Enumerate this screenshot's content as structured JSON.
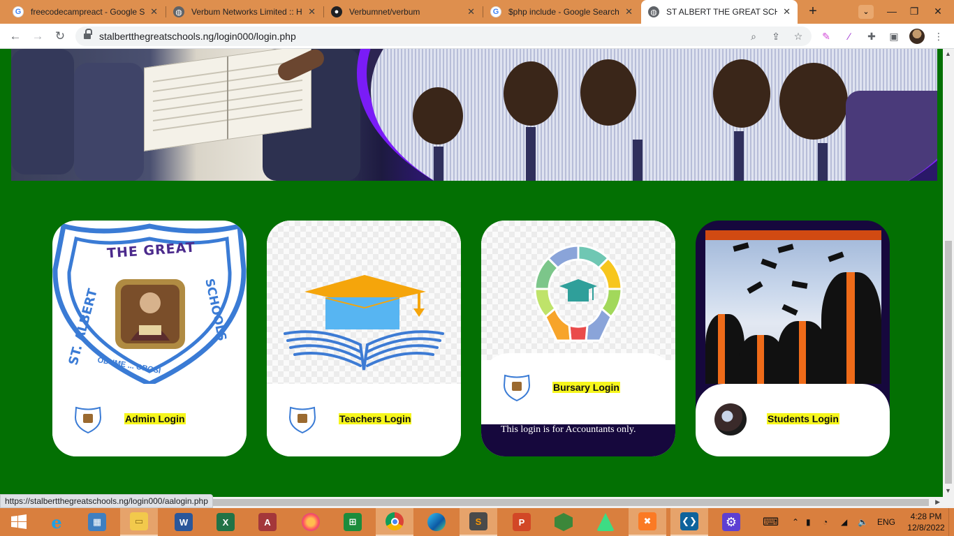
{
  "browser": {
    "tabs": [
      {
        "title": "freecodecampreact - Google S",
        "favicon": "google-icon"
      },
      {
        "title": "Verbum Networks Limited :: Ho",
        "favicon": "globe-icon"
      },
      {
        "title": "Verbumnet/verbum",
        "favicon": "github-icon"
      },
      {
        "title": "$php include - Google Search",
        "favicon": "google-icon"
      },
      {
        "title": "ST ALBERT THE GREAT SCHOO",
        "favicon": "globe-icon",
        "active": true
      }
    ],
    "url": "stalbertthegreatschools.ng/login000/login.php",
    "status_url": "https://stalbertthegreatschools.ng/login000/aalogin.php"
  },
  "colors": {
    "tabbar": "#de8f4e",
    "page_background": "#037003",
    "label_highlight": "#f6f61c",
    "note_strip": "#16083d",
    "hero_arc": "#7a1cf7"
  },
  "crest": {
    "top_text": "THE GREAT",
    "left_text": "ST. ALBERT",
    "right_text": "SCHOOLS",
    "bottom_text": "ODUME ... OBOSI"
  },
  "cards": [
    {
      "label": "Admin Login",
      "image": "school-crest",
      "icon": "crest-icon"
    },
    {
      "label": "Teachers Login",
      "image": "graduation-book-icon",
      "icon": "crest-icon"
    },
    {
      "label": "Bursary Login",
      "image": "lightbulb-education-icon",
      "icon": "crest-icon",
      "note": "This login is for Accountants only."
    },
    {
      "label": "Students Login",
      "image": "graduates-photo",
      "icon": "graduates-avatar"
    }
  ],
  "taskbar": {
    "apps": [
      "start",
      "internet-explorer",
      "control-panel",
      "file-explorer",
      "word",
      "excel",
      "access",
      "firefox",
      "store",
      "chrome",
      "edge",
      "sublime-text",
      "powerpoint",
      "node",
      "android-studio",
      "xampp",
      "vscode",
      "settings"
    ],
    "language": "ENG",
    "time": "4:28 PM",
    "date": "12/8/2022"
  }
}
